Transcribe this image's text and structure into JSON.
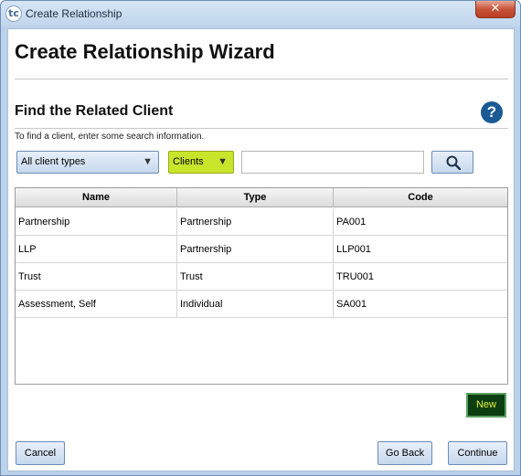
{
  "window": {
    "title": "Create Relationship",
    "app_icon_glyph": "tc",
    "close_glyph": "✕"
  },
  "wizard": {
    "title": "Create Relationship Wizard",
    "section_title": "Find the Related Client",
    "help_glyph": "?",
    "instruction": "To find a client, enter some search information."
  },
  "search": {
    "client_type_selected": "All client types",
    "filter_selected": "Clients",
    "query_value": "",
    "query_placeholder": "",
    "filter_highlight_color": "#c9e52b",
    "dropdown_arrow_glyph": "▼"
  },
  "table": {
    "columns": [
      "Name",
      "Type",
      "Code"
    ],
    "rows": [
      {
        "name": "Partnership",
        "type": "Partnership",
        "code": "PA001"
      },
      {
        "name": "LLP",
        "type": "Partnership",
        "code": "LLP001"
      },
      {
        "name": "Trust",
        "type": "Trust",
        "code": "TRU001"
      },
      {
        "name": "Assessment, Self",
        "type": "Individual",
        "code": "SA001"
      }
    ]
  },
  "buttons": {
    "new_label": "New",
    "cancel_label": "Cancel",
    "go_back_label": "Go Back",
    "continue_label": "Continue"
  },
  "colors": {
    "help_icon": "#1a5a94",
    "new_button_bg": "#0c3e11",
    "new_button_text": "#e8f238"
  },
  "icons": {
    "search_button": "search-icon",
    "help": "help-icon",
    "close": "close-icon",
    "app": "app-logo-icon"
  }
}
